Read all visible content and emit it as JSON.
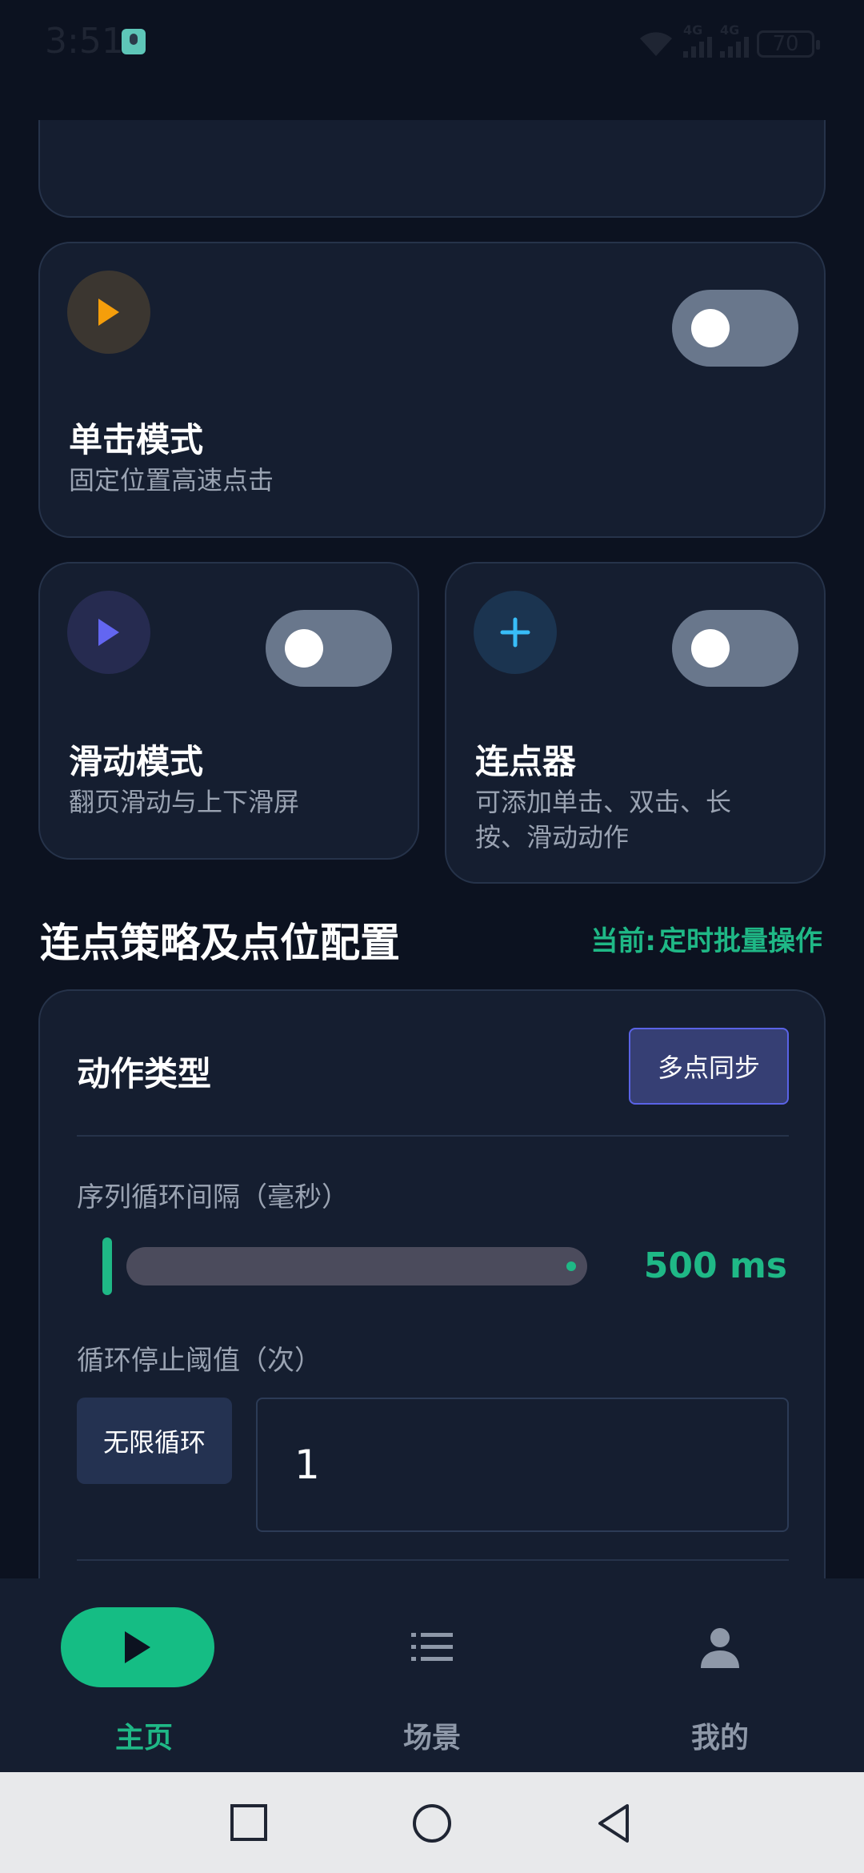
{
  "status_bar": {
    "time": "3:51",
    "net_tag_1": "4G",
    "net_tag_2": "4G",
    "battery": "70"
  },
  "modes": {
    "single": {
      "title": "单击模式",
      "subtitle": "固定位置高速点击",
      "icon": "play-icon",
      "icon_color": "#f59e0b",
      "enabled": false
    },
    "swipe": {
      "title": "滑动模式",
      "subtitle": "翻页滑动与上下滑屏",
      "icon": "play-icon",
      "icon_color": "#6366f1",
      "enabled": false
    },
    "combo": {
      "title": "连点器",
      "subtitle_line1": "可添加单击、双击、长",
      "subtitle_line2": "按、滑动动作",
      "icon": "plus-icon",
      "icon_color": "#38bdf8",
      "enabled": false
    }
  },
  "strategy": {
    "title": "连点策略及点位配置",
    "current_label": "当前:",
    "current_value": "定时批量操作"
  },
  "config": {
    "action_type_label": "动作类型",
    "action_type_value": "多点同步",
    "interval_label": "序列循环间隔（毫秒）",
    "interval_value": "500 ms",
    "stop_label": "循环停止阈值（次）",
    "infinite_label": "无限循环",
    "stop_count": "1"
  },
  "bottom_nav": {
    "items": [
      {
        "label": "主页",
        "icon": "play-icon",
        "active": true
      },
      {
        "label": "场景",
        "icon": "list-icon",
        "active": false
      },
      {
        "label": "我的",
        "icon": "person-icon",
        "active": false
      }
    ]
  },
  "colors": {
    "accent": "#1fb886",
    "background": "#0c1220",
    "card": "#151e30"
  }
}
